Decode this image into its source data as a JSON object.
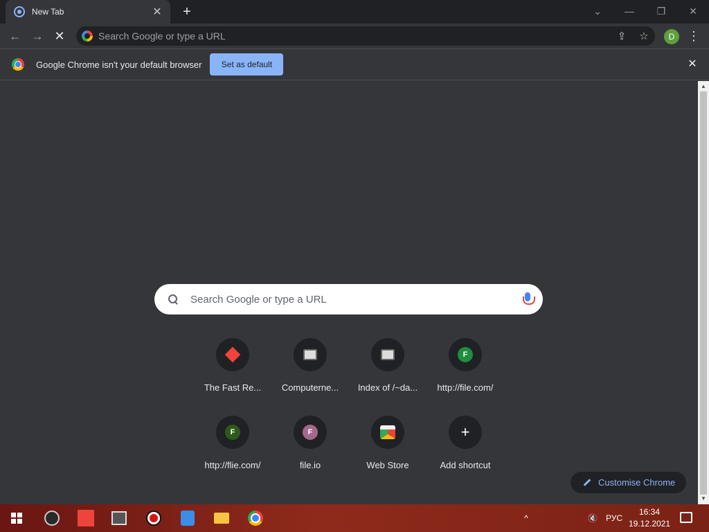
{
  "browser": {
    "tab": {
      "title": "New Tab",
      "close": "✕"
    },
    "new_tab": "+",
    "window_controls": {
      "tab_search": "⌄",
      "minimize": "—",
      "restore": "❐",
      "close": "✕"
    },
    "nav": {
      "back": "←",
      "forward": "→",
      "stop": "✕"
    },
    "omnibox": {
      "placeholder": "Search Google or type a URL",
      "share": "⇪",
      "bookmark": "☆"
    },
    "profile_initial": "D",
    "menu": "⋮"
  },
  "infobar": {
    "message": "Google Chrome isn't your default browser",
    "button": "Set as default",
    "close": "✕"
  },
  "ntp": {
    "search_placeholder": "Search Google or type a URL",
    "shortcuts": [
      {
        "title": "The Fast Re...",
        "icon": "anydesk-icon"
      },
      {
        "title": "Computerne...",
        "icon": "computer-icon"
      },
      {
        "title": "Index of /~da...",
        "icon": "computer-icon"
      },
      {
        "title": "http://file.com/",
        "icon": "letter-icon",
        "letter": "F",
        "color": "#1e8e3e"
      },
      {
        "title": "http://flie.com/",
        "icon": "letter-icon",
        "letter": "F",
        "color": "#2d5a1b"
      },
      {
        "title": "file.io",
        "icon": "letter-icon",
        "letter": "F",
        "color": "#a4688a"
      },
      {
        "title": "Web Store",
        "icon": "web-store-icon"
      },
      {
        "title": "Add shortcut",
        "icon": "plus-icon",
        "symbol": "+"
      }
    ],
    "customise": "Customise Chrome"
  },
  "taskbar": {
    "apps": [
      "start",
      "obs",
      "anydesk",
      "video-editor",
      "screen-recorder",
      "media-player",
      "file-explorer",
      "chrome"
    ],
    "tray": {
      "chevron": "^",
      "volume": "🔇",
      "language": "РУС"
    },
    "time": "16:34",
    "date": "19.12.2021"
  }
}
